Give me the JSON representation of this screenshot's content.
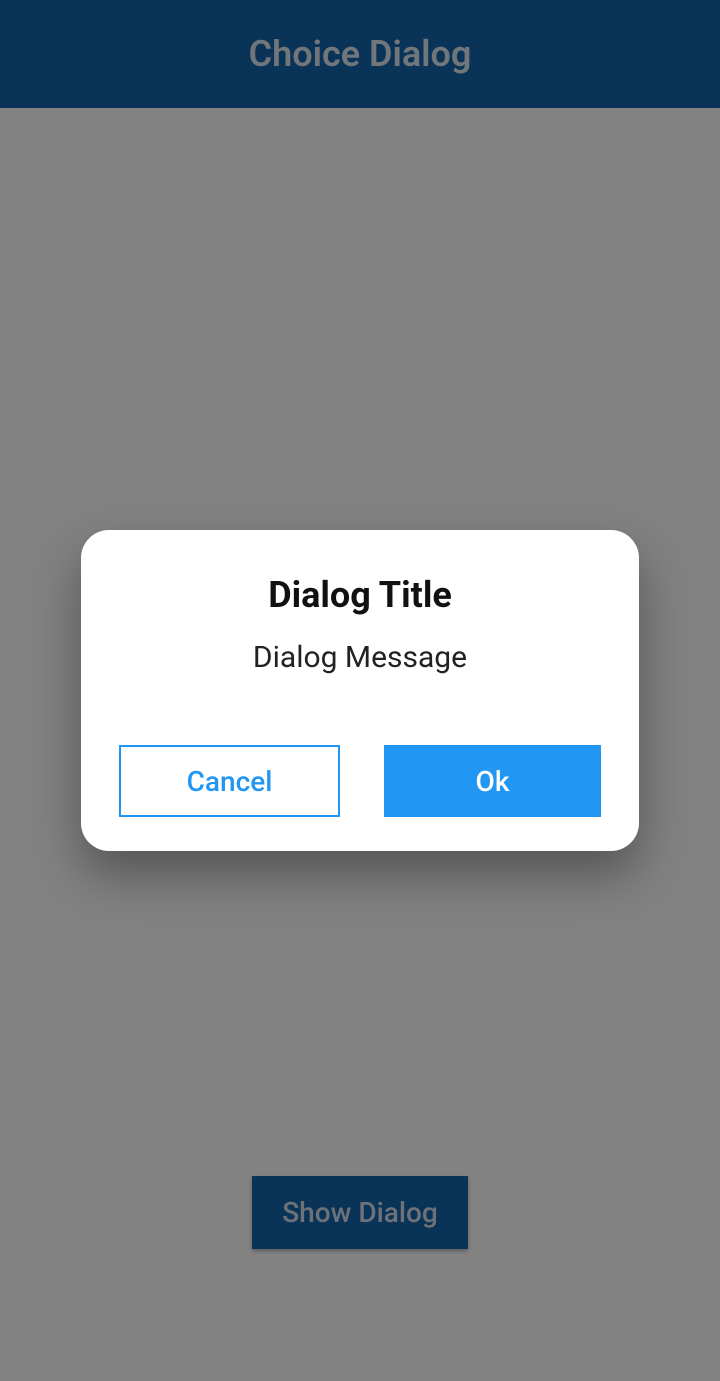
{
  "appbar": {
    "title": "Choice Dialog"
  },
  "main": {
    "show_button_label": "Show Dialog"
  },
  "dialog": {
    "title": "Dialog Title",
    "message": "Dialog Message",
    "cancel_label": "Cancel",
    "ok_label": "Ok"
  },
  "colors": {
    "primary": "#1565a7",
    "accent": "#2196F3"
  }
}
